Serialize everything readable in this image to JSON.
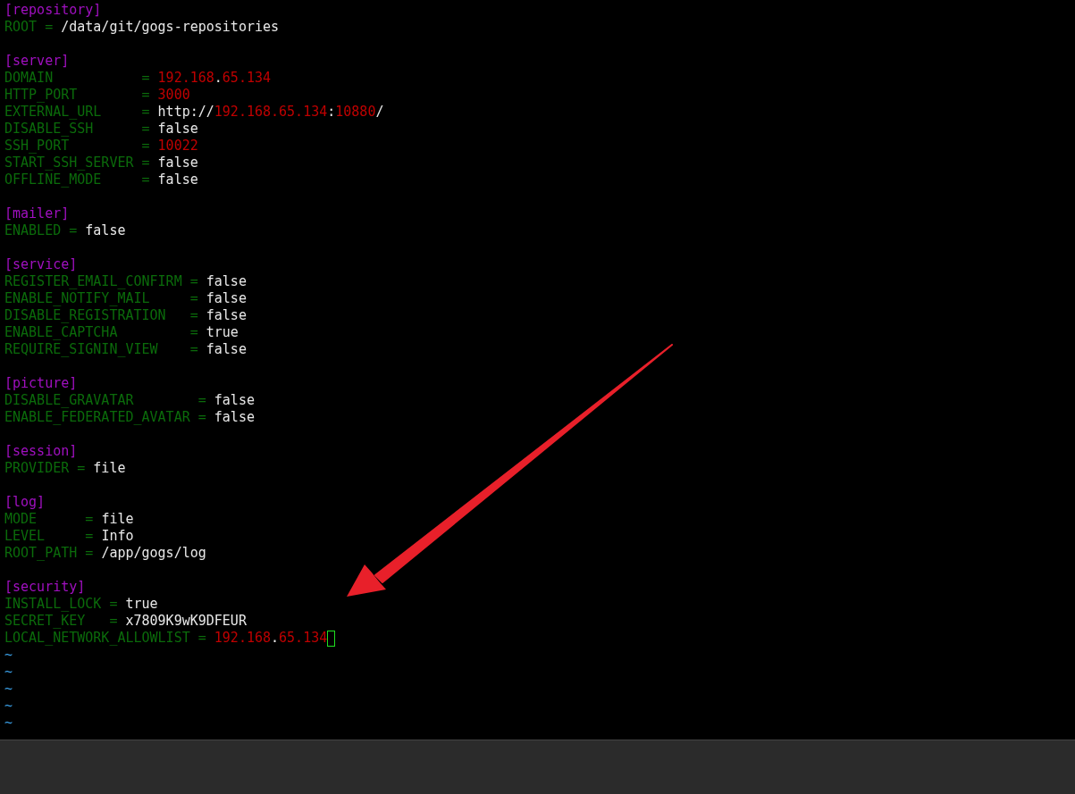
{
  "lines": [
    {
      "kind": "code",
      "runs": [
        {
          "kind": "section",
          "text": "[repository]"
        }
      ]
    },
    {
      "kind": "code",
      "runs": [
        {
          "kind": "key",
          "text": "ROOT = "
        },
        {
          "kind": "str",
          "text": "/data/git/gogs-repositories"
        }
      ]
    },
    {
      "kind": "blank"
    },
    {
      "kind": "code",
      "runs": [
        {
          "kind": "section",
          "text": "[server]"
        }
      ]
    },
    {
      "kind": "code",
      "runs": [
        {
          "kind": "key",
          "text": "DOMAIN           = "
        },
        {
          "kind": "num",
          "text": "192.168"
        },
        {
          "kind": "str",
          "text": "."
        },
        {
          "kind": "num",
          "text": "65.134"
        }
      ]
    },
    {
      "kind": "code",
      "runs": [
        {
          "kind": "key",
          "text": "HTTP_PORT        = "
        },
        {
          "kind": "num",
          "text": "3000"
        }
      ]
    },
    {
      "kind": "code",
      "runs": [
        {
          "kind": "key",
          "text": "EXTERNAL_URL     = "
        },
        {
          "kind": "str",
          "text": "http://"
        },
        {
          "kind": "num",
          "text": "192.168.65.134"
        },
        {
          "kind": "str",
          "text": ":"
        },
        {
          "kind": "num",
          "text": "10880"
        },
        {
          "kind": "str",
          "text": "/"
        }
      ]
    },
    {
      "kind": "code",
      "runs": [
        {
          "kind": "key",
          "text": "DISABLE_SSH      = "
        },
        {
          "kind": "str",
          "text": "false"
        }
      ]
    },
    {
      "kind": "code",
      "runs": [
        {
          "kind": "key",
          "text": "SSH_PORT         = "
        },
        {
          "kind": "num",
          "text": "10022"
        }
      ]
    },
    {
      "kind": "code",
      "runs": [
        {
          "kind": "key",
          "text": "START_SSH_SERVER = "
        },
        {
          "kind": "str",
          "text": "false"
        }
      ]
    },
    {
      "kind": "code",
      "runs": [
        {
          "kind": "key",
          "text": "OFFLINE_MODE     = "
        },
        {
          "kind": "str",
          "text": "false"
        }
      ]
    },
    {
      "kind": "blank"
    },
    {
      "kind": "code",
      "runs": [
        {
          "kind": "section",
          "text": "[mailer]"
        }
      ]
    },
    {
      "kind": "code",
      "runs": [
        {
          "kind": "key",
          "text": "ENABLED = "
        },
        {
          "kind": "str",
          "text": "false"
        }
      ]
    },
    {
      "kind": "blank"
    },
    {
      "kind": "code",
      "runs": [
        {
          "kind": "section",
          "text": "[service]"
        }
      ]
    },
    {
      "kind": "code",
      "runs": [
        {
          "kind": "key",
          "text": "REGISTER_EMAIL_CONFIRM = "
        },
        {
          "kind": "str",
          "text": "false"
        }
      ]
    },
    {
      "kind": "code",
      "runs": [
        {
          "kind": "key",
          "text": "ENABLE_NOTIFY_MAIL     = "
        },
        {
          "kind": "str",
          "text": "false"
        }
      ]
    },
    {
      "kind": "code",
      "runs": [
        {
          "kind": "key",
          "text": "DISABLE_REGISTRATION   = "
        },
        {
          "kind": "str",
          "text": "false"
        }
      ]
    },
    {
      "kind": "code",
      "runs": [
        {
          "kind": "key",
          "text": "ENABLE_CAPTCHA         = "
        },
        {
          "kind": "str",
          "text": "true"
        }
      ]
    },
    {
      "kind": "code",
      "runs": [
        {
          "kind": "key",
          "text": "REQUIRE_SIGNIN_VIEW    = "
        },
        {
          "kind": "str",
          "text": "false"
        }
      ]
    },
    {
      "kind": "blank"
    },
    {
      "kind": "code",
      "runs": [
        {
          "kind": "section",
          "text": "[picture]"
        }
      ]
    },
    {
      "kind": "code",
      "runs": [
        {
          "kind": "key",
          "text": "DISABLE_GRAVATAR        = "
        },
        {
          "kind": "str",
          "text": "false"
        }
      ]
    },
    {
      "kind": "code",
      "runs": [
        {
          "kind": "key",
          "text": "ENABLE_FEDERATED_AVATAR = "
        },
        {
          "kind": "str",
          "text": "false"
        }
      ]
    },
    {
      "kind": "blank"
    },
    {
      "kind": "code",
      "runs": [
        {
          "kind": "section",
          "text": "[session]"
        }
      ]
    },
    {
      "kind": "code",
      "runs": [
        {
          "kind": "key",
          "text": "PROVIDER = "
        },
        {
          "kind": "str",
          "text": "file"
        }
      ]
    },
    {
      "kind": "blank"
    },
    {
      "kind": "code",
      "runs": [
        {
          "kind": "section",
          "text": "[log]"
        }
      ]
    },
    {
      "kind": "code",
      "runs": [
        {
          "kind": "key",
          "text": "MODE      = "
        },
        {
          "kind": "str",
          "text": "file"
        }
      ]
    },
    {
      "kind": "code",
      "runs": [
        {
          "kind": "key",
          "text": "LEVEL     = "
        },
        {
          "kind": "str",
          "text": "Info"
        }
      ]
    },
    {
      "kind": "code",
      "runs": [
        {
          "kind": "key",
          "text": "ROOT_PATH = "
        },
        {
          "kind": "str",
          "text": "/app/gogs/log"
        }
      ]
    },
    {
      "kind": "blank"
    },
    {
      "kind": "code",
      "runs": [
        {
          "kind": "section",
          "text": "[security]"
        }
      ]
    },
    {
      "kind": "code",
      "runs": [
        {
          "kind": "key",
          "text": "INSTALL_LOCK = "
        },
        {
          "kind": "str",
          "text": "true"
        }
      ]
    },
    {
      "kind": "code",
      "runs": [
        {
          "kind": "key",
          "text": "SECRET_KEY   = "
        },
        {
          "kind": "str",
          "text": "x7809K9wK9DFEUR"
        }
      ]
    },
    {
      "kind": "code",
      "cursor": true,
      "runs": [
        {
          "kind": "key",
          "text": "LOCAL_NETWORK_ALLOWLIST = "
        },
        {
          "kind": "num",
          "text": "192.168"
        },
        {
          "kind": "str",
          "text": "."
        },
        {
          "kind": "num",
          "text": "65.134"
        }
      ]
    },
    {
      "kind": "tilde",
      "text": "~"
    },
    {
      "kind": "tilde",
      "text": "~"
    },
    {
      "kind": "tilde",
      "text": "~"
    },
    {
      "kind": "tilde",
      "text": "~"
    },
    {
      "kind": "tilde",
      "text": "~"
    }
  ]
}
